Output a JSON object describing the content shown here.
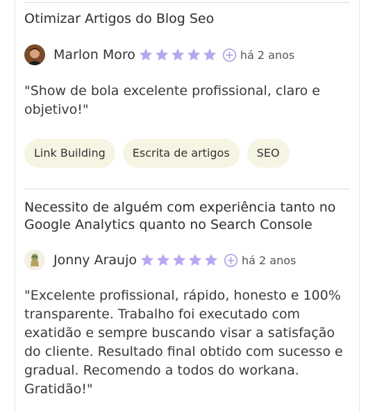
{
  "reviews": [
    {
      "title": "Otimizar Artigos do Blog Seo",
      "author": "Marlon Moro",
      "rating": 5,
      "time": "há 2 anos",
      "comment": "\"Show de bola excelente profissional, claro e objetivo!\"",
      "tags": [
        "Link Building",
        "Escrita de artigos",
        "SEO"
      ]
    },
    {
      "title": "Necessito de alguém com experiência tanto no Google Analytics quanto no Search Console",
      "author": "Jonny Araujo",
      "rating": 5,
      "time": "há 2 anos",
      "comment": "\"Excelente profissional, rápido, honesto e 100% transparente. Trabalho foi executado com exatidão e sempre buscando visar a satisfação do cliente. Resultado final obtido com sucesso e gradual. Recomendo a todos do workana. Gratidão!\""
    }
  ],
  "colors": {
    "star": "#b8a7f0",
    "plus_icon": "#a99be0",
    "tag_bg": "#f6f4e3"
  },
  "icons": {
    "star": "star-icon",
    "plus": "plus-circle-icon"
  }
}
